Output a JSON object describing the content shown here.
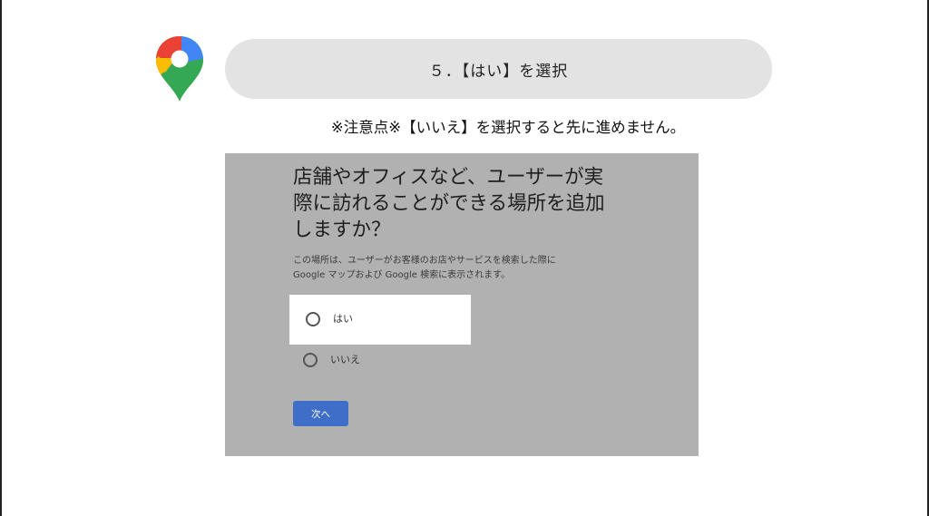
{
  "step": {
    "label": "５．【はい】を選択"
  },
  "note": {
    "text": "※注意点※【いいえ】を選択すると先に進めません。"
  },
  "form": {
    "heading_lines": [
      "店舗やオフィスなど、ユーザーが実",
      "際に訪れることができる場所を追加",
      "しますか？"
    ],
    "description_lines": [
      "この場所は、ユーザーがお客様のお店やサービスを検索した際に",
      "Google マップおよび Google 検索に表示されます。"
    ],
    "options": [
      {
        "label": "はい"
      },
      {
        "label": "いいえ"
      }
    ],
    "next_button": "次へ"
  },
  "icons": {
    "logo": "google-maps-pin-icon",
    "radio": "radio-unchecked-icon"
  },
  "colors": {
    "pill": "#e3e3e3",
    "screenshot_bg": "#b1b1b1",
    "button": "#3f6ec8"
  }
}
